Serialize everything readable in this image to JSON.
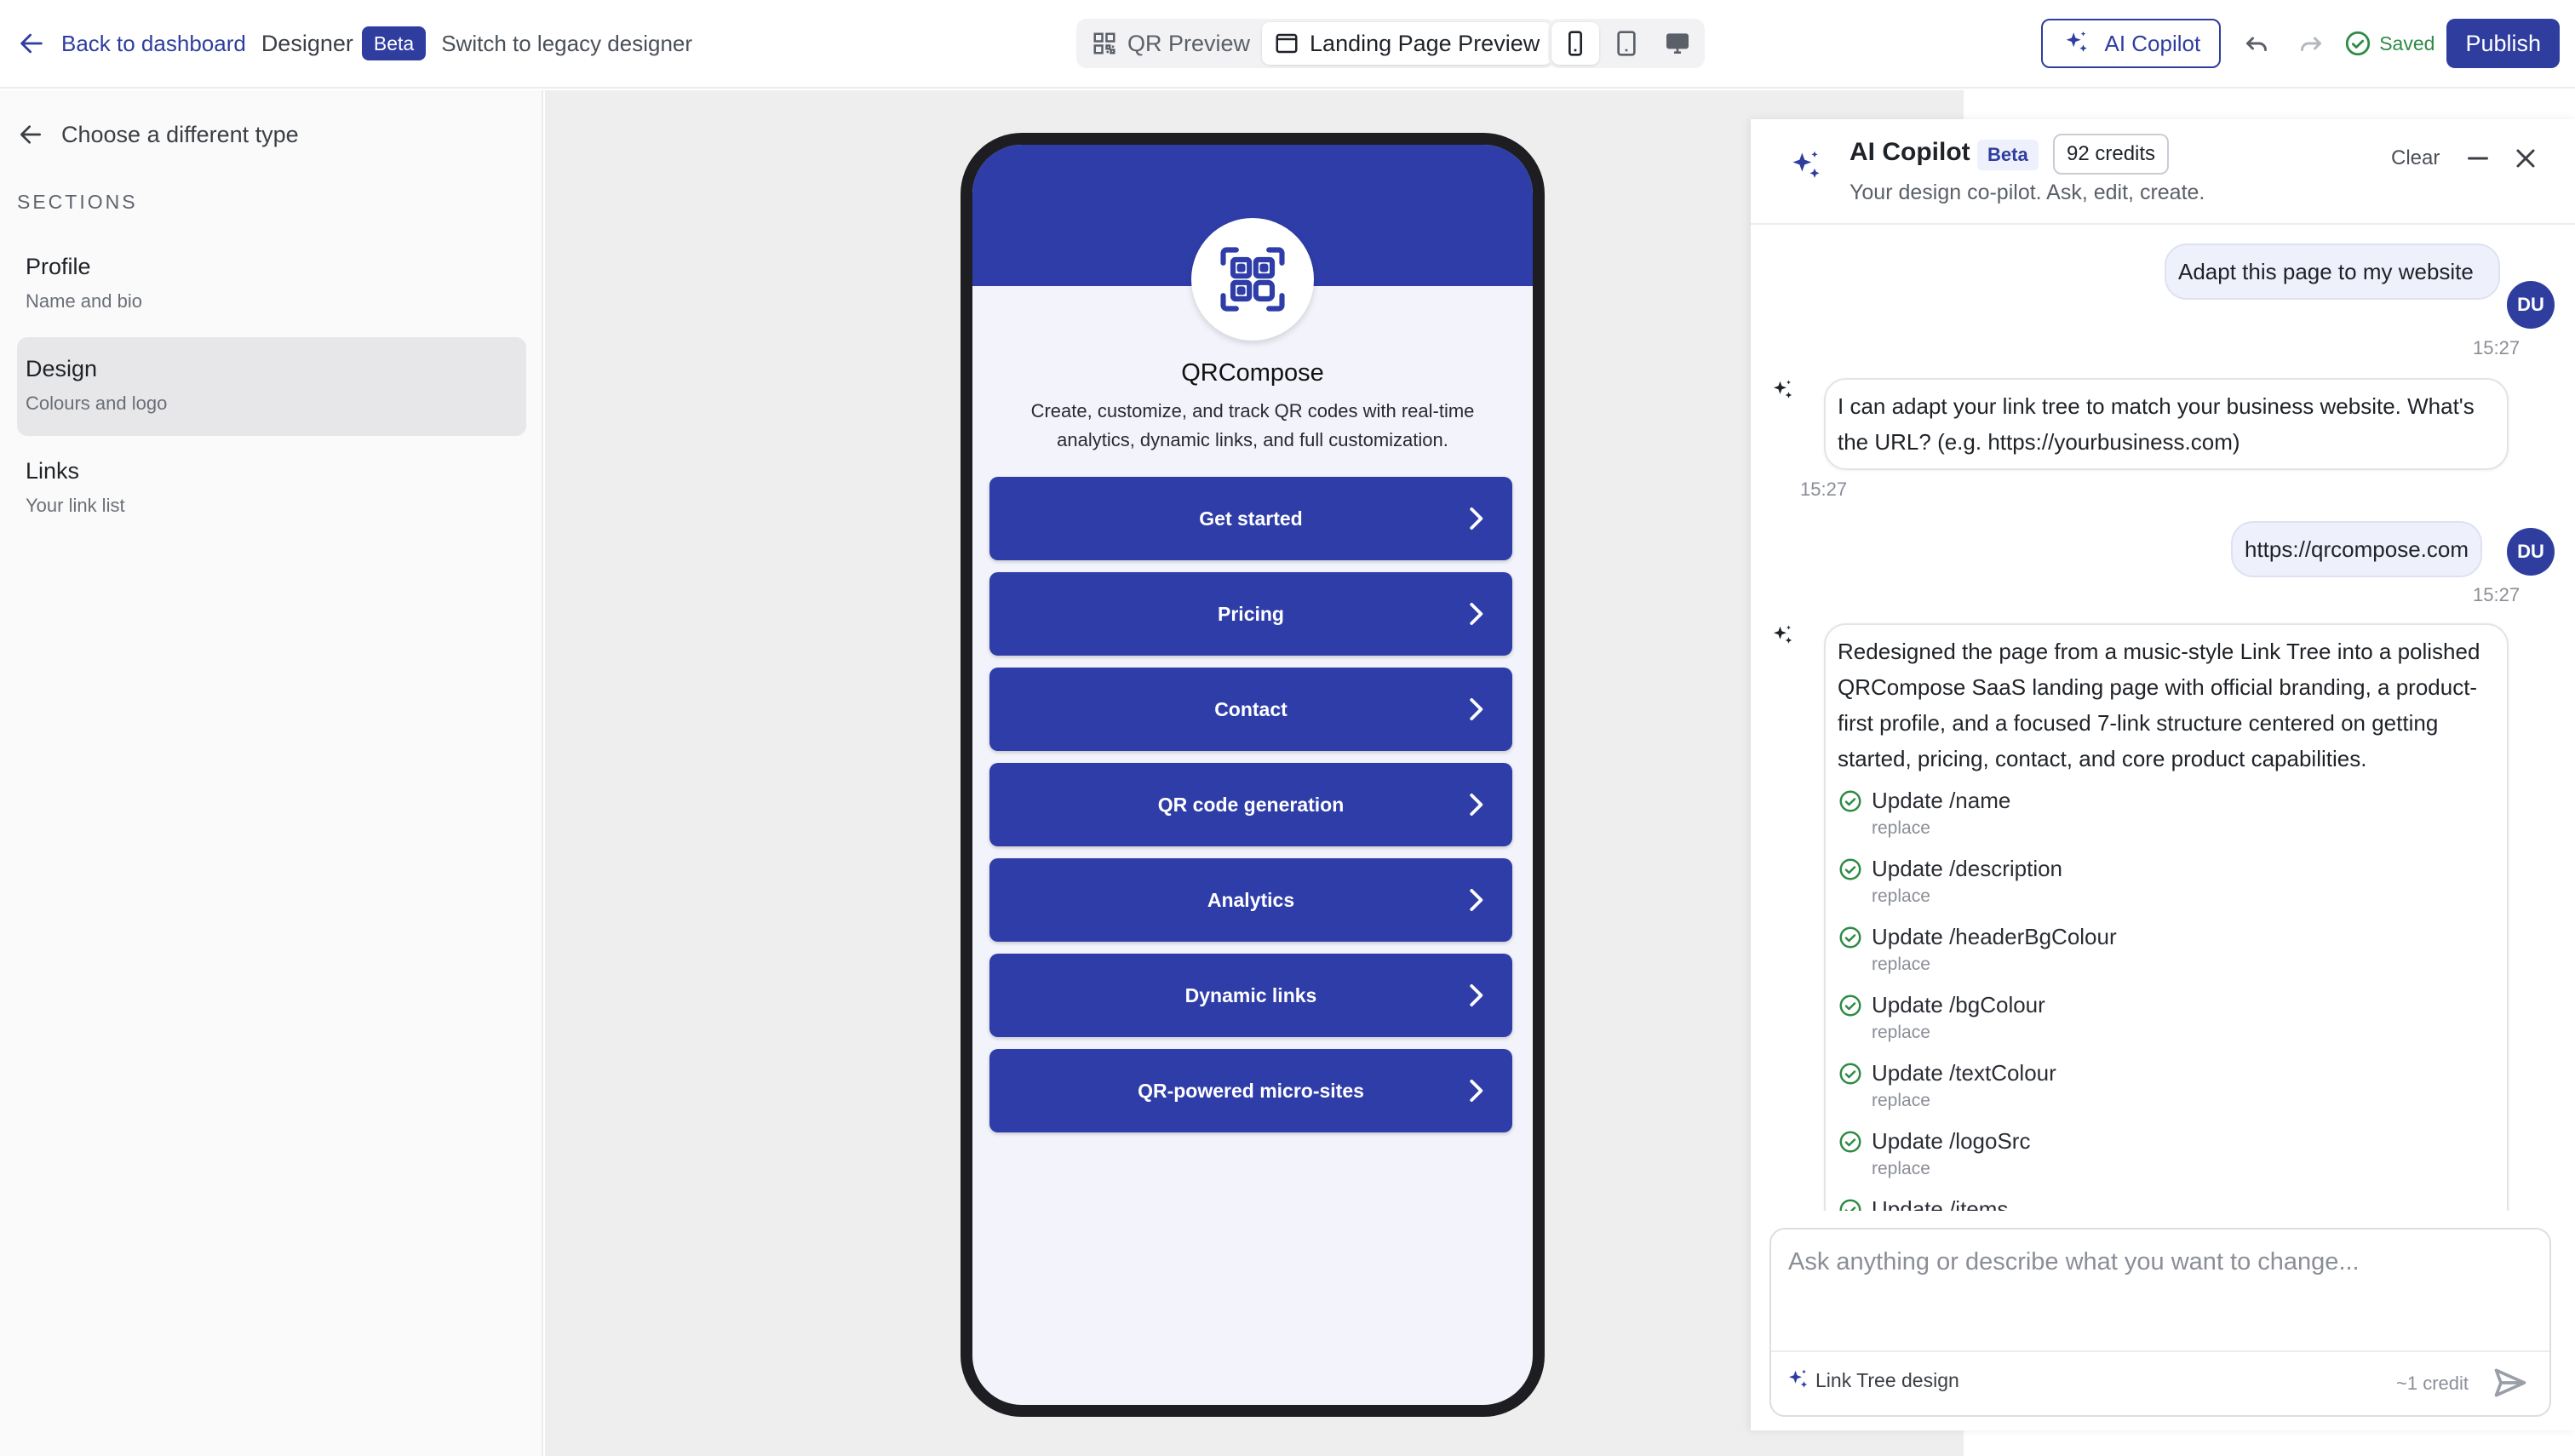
{
  "header": {
    "back_label": "Back to dashboard",
    "designer_label": "Designer",
    "beta_label": "Beta",
    "legacy_label": "Switch to legacy designer",
    "preview_tabs": [
      {
        "label": "QR Preview",
        "icon": "qr-icon",
        "active": false
      },
      {
        "label": "Landing Page Preview",
        "icon": "window-icon",
        "active": true
      }
    ],
    "devices": [
      {
        "icon": "mobile-icon",
        "active": true
      },
      {
        "icon": "tablet-icon",
        "active": false
      },
      {
        "icon": "desktop-icon",
        "active": false
      }
    ],
    "copilot_label": "AI Copilot",
    "saved_label": "Saved",
    "publish_label": "Publish"
  },
  "sidebar": {
    "choose_type_label": "Choose a different type",
    "sections_heading": "SECTIONS",
    "items": [
      {
        "title": "Profile",
        "subtitle": "Name and bio",
        "active": false
      },
      {
        "title": "Design",
        "subtitle": "Colours and logo",
        "active": true
      },
      {
        "title": "Links",
        "subtitle": "Your link list",
        "active": false
      }
    ]
  },
  "preview": {
    "name": "QRCompose",
    "description": "Create, customize, and track QR codes with real-time analytics, dynamic links, and full customization.",
    "links": [
      "Get started",
      "Pricing",
      "Contact",
      "QR code generation",
      "Analytics",
      "Dynamic links",
      "QR-powered micro-sites"
    ]
  },
  "copilot": {
    "title": "AI Copilot",
    "beta_label": "Beta",
    "credits_label": "92 credits",
    "subtitle": "Your design co-pilot. Ask, edit, create.",
    "clear_label": "Clear",
    "messages": [
      {
        "role": "user",
        "text": "Adapt this page to my website",
        "time": "15:27",
        "avatar": "DU"
      },
      {
        "role": "assistant",
        "text": "I can adapt your link tree to match your business website. What's the URL? (e.g. https://yourbusiness.com)",
        "time": "15:27"
      },
      {
        "role": "user",
        "text": "https://qrcompose.com",
        "time": "15:27",
        "avatar": "DU"
      },
      {
        "role": "assistant",
        "text": "Redesigned the page from a music-style Link Tree into a polished QRCompose SaaS landing page with official branding, a product-first profile, and a focused 7-link structure centered on getting started, pricing, contact, and core product capabilities.",
        "changes": [
          {
            "title": "Update /name",
            "op": "replace"
          },
          {
            "title": "Update /description",
            "op": "replace"
          },
          {
            "title": "Update /headerBgColour",
            "op": "replace"
          },
          {
            "title": "Update /bgColour",
            "op": "replace"
          },
          {
            "title": "Update /textColour",
            "op": "replace"
          },
          {
            "title": "Update /logoSrc",
            "op": "replace"
          },
          {
            "title": "Update /items",
            "op": ""
          }
        ]
      }
    ],
    "input_placeholder": "Ask anything or describe what you want to change...",
    "mode_label": "Link Tree design",
    "cost_label": "~1 credit"
  },
  "colors": {
    "brand": "#2f3e9e",
    "preview_header": "#2f3da8",
    "preview_bg": "#f3f4fb",
    "saved_green": "#2e8b45"
  }
}
